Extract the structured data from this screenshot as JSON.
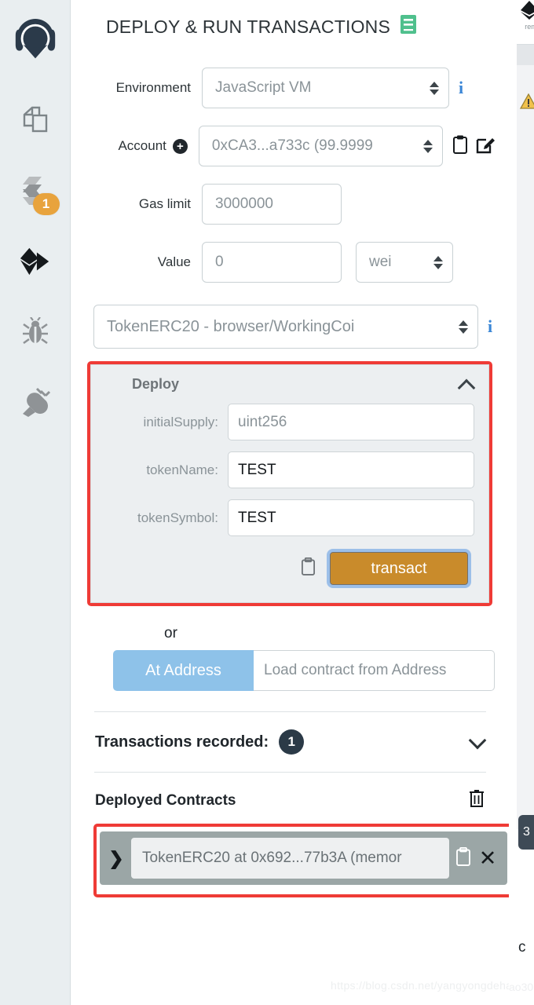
{
  "sidebar": {
    "items": [
      {
        "name": "remix-home-logo",
        "icon": "remix-logo-icon",
        "label": ""
      },
      {
        "name": "file-explorers",
        "icon": "files-copy-icon",
        "label": ""
      },
      {
        "name": "solidity-compiler",
        "icon": "solidity-compiler-icon",
        "label": "",
        "badge": "1"
      },
      {
        "name": "deploy-run-transactions",
        "icon": "ethereum-diamond-icon",
        "label": ""
      },
      {
        "name": "debugger",
        "icon": "bug-icon",
        "label": ""
      },
      {
        "name": "plugin-manager",
        "icon": "plug-icon",
        "label": ""
      }
    ]
  },
  "header": {
    "title": "DEPLOY & RUN TRANSACTIONS",
    "doc_icon": "book-icon"
  },
  "form": {
    "environment": {
      "label": "Environment",
      "value": "JavaScript VM",
      "info_icon": "info-icon"
    },
    "account": {
      "label": "Account",
      "add_icon": "plus-circle-icon",
      "value": "0xCA3...a733c (99.9999",
      "copy_icon": "clipboard-icon",
      "edit_icon": "edit-square-icon"
    },
    "gas_limit": {
      "label": "Gas limit",
      "value": "3000000"
    },
    "value": {
      "label": "Value",
      "value": "0",
      "unit": "wei"
    },
    "contract": {
      "value": "TokenERC20 - browser/WorkingCoi",
      "info_icon": "info-icon"
    }
  },
  "deploy": {
    "title": "Deploy",
    "collapse_icon": "chevron-up-icon",
    "args": [
      {
        "label": "initialSupply:",
        "value": "uint256",
        "is_placeholder": true
      },
      {
        "label": "tokenName:",
        "value": "TEST",
        "is_placeholder": false
      },
      {
        "label": "tokenSymbol:",
        "value": "TEST",
        "is_placeholder": false
      }
    ],
    "copy_icon": "clipboard-icon",
    "transact_label": "transact",
    "transact_color": "#c98b2b",
    "focus_ring_color": "#9cbfe8",
    "highlight_color": "#ef3b36"
  },
  "at_address": {
    "or_text": "or",
    "button_label": "At Address",
    "placeholder": "Load contract from Address",
    "button_color": "#8ec2e9"
  },
  "transactions_recorded": {
    "label": "Transactions recorded:",
    "count": "1",
    "expand_icon": "chevron-down-icon",
    "badge_color": "#2b3a47"
  },
  "deployed_contracts": {
    "title": "Deployed Contracts",
    "trash_icon": "trash-icon",
    "rows": [
      {
        "expand_icon": "chevron-right-icon",
        "label": "TokenERC20 at 0x692...77b3A (memor",
        "copy_icon": "clipboard-icon",
        "close_icon": "close-icon"
      }
    ],
    "highlight_color": "#ef3b36"
  },
  "right_strip": {
    "tab_label": "rem",
    "warning_icon": "warning-triangle-icon",
    "button_label": "3",
    "char": "c"
  },
  "watermark": {
    "text": "https://blog.csdn.net/yangyongdehao30"
  }
}
